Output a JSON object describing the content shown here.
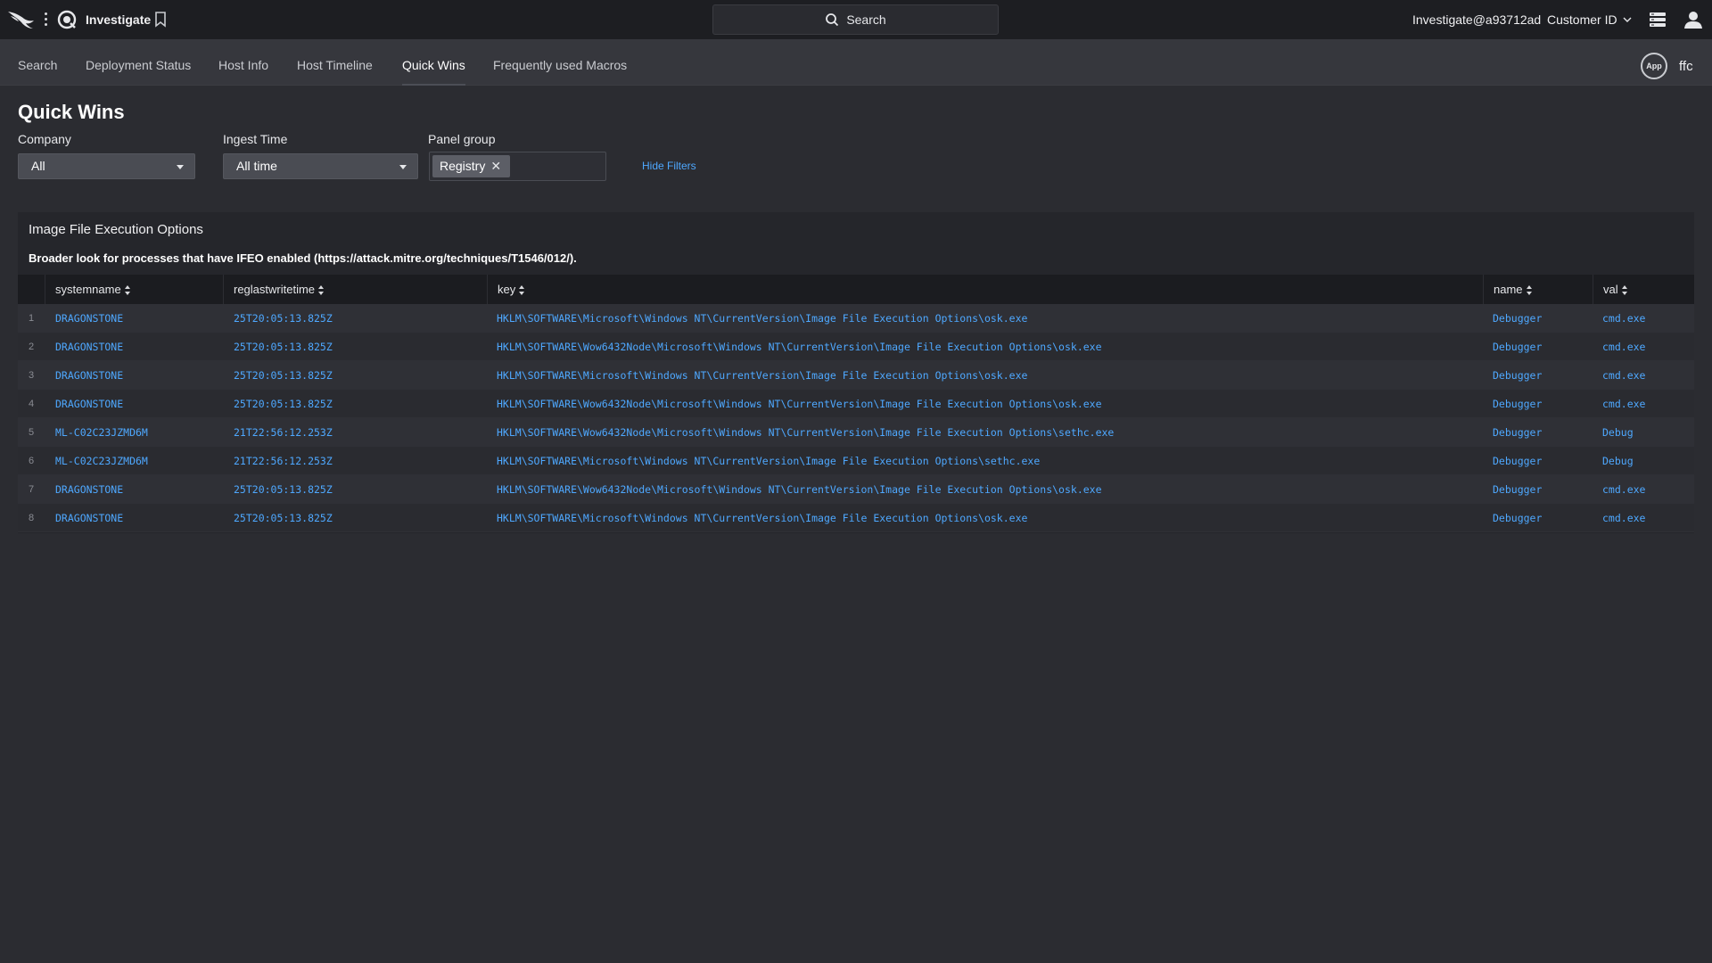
{
  "topbar": {
    "app_name": "Investigate",
    "search_label": "Search",
    "user": "Investigate@a93712ad",
    "customer_label": "Customer ID"
  },
  "tabs": [
    {
      "label": "Search"
    },
    {
      "label": "Deployment Status"
    },
    {
      "label": "Host Info"
    },
    {
      "label": "Host Timeline"
    },
    {
      "label": "Quick Wins",
      "active": true
    },
    {
      "label": "Frequently used Macros"
    }
  ],
  "app_badge": "App",
  "org_code": "ffc",
  "page": {
    "title": "Quick Wins",
    "filters": {
      "company": {
        "label": "Company",
        "value": "All"
      },
      "ingest_time": {
        "label": "Ingest Time",
        "value": "All time"
      },
      "panel_group": {
        "label": "Panel group",
        "chips": [
          "Registry"
        ]
      },
      "hide_filters": "Hide Filters"
    }
  },
  "panel": {
    "title": "Image File Execution Options",
    "description": "Broader look for processes that have IFEO enabled (https://attack.mitre.org/techniques/T1546/012/).",
    "columns": [
      "systemname",
      "reglastwritetime",
      "key",
      "name",
      "val"
    ],
    "rows": [
      {
        "idx": "1",
        "systemname": "DRAGONSTONE",
        "reglastwritetime": "25T20:05:13.825Z",
        "key": "HKLM\\SOFTWARE\\Microsoft\\Windows NT\\CurrentVersion\\Image File Execution Options\\osk.exe",
        "name": "Debugger",
        "val": "cmd.exe"
      },
      {
        "idx": "2",
        "systemname": "DRAGONSTONE",
        "reglastwritetime": "25T20:05:13.825Z",
        "key": "HKLM\\SOFTWARE\\Wow6432Node\\Microsoft\\Windows NT\\CurrentVersion\\Image File Execution Options\\osk.exe",
        "name": "Debugger",
        "val": "cmd.exe"
      },
      {
        "idx": "3",
        "systemname": "DRAGONSTONE",
        "reglastwritetime": "25T20:05:13.825Z",
        "key": "HKLM\\SOFTWARE\\Microsoft\\Windows NT\\CurrentVersion\\Image File Execution Options\\osk.exe",
        "name": "Debugger",
        "val": "cmd.exe"
      },
      {
        "idx": "4",
        "systemname": "DRAGONSTONE",
        "reglastwritetime": "25T20:05:13.825Z",
        "key": "HKLM\\SOFTWARE\\Wow6432Node\\Microsoft\\Windows NT\\CurrentVersion\\Image File Execution Options\\osk.exe",
        "name": "Debugger",
        "val": "cmd.exe"
      },
      {
        "idx": "5",
        "systemname": "ML-C02C23JZMD6M",
        "reglastwritetime": "21T22:56:12.253Z",
        "key": "HKLM\\SOFTWARE\\Wow6432Node\\Microsoft\\Windows NT\\CurrentVersion\\Image File Execution Options\\sethc.exe",
        "name": "Debugger",
        "val": "Debug"
      },
      {
        "idx": "6",
        "systemname": "ML-C02C23JZMD6M",
        "reglastwritetime": "21T22:56:12.253Z",
        "key": "HKLM\\SOFTWARE\\Microsoft\\Windows NT\\CurrentVersion\\Image File Execution Options\\sethc.exe",
        "name": "Debugger",
        "val": "Debug"
      },
      {
        "idx": "7",
        "systemname": "DRAGONSTONE",
        "reglastwritetime": "25T20:05:13.825Z",
        "key": "HKLM\\SOFTWARE\\Wow6432Node\\Microsoft\\Windows NT\\CurrentVersion\\Image File Execution Options\\osk.exe",
        "name": "Debugger",
        "val": "cmd.exe"
      },
      {
        "idx": "8",
        "systemname": "DRAGONSTONE",
        "reglastwritetime": "25T20:05:13.825Z",
        "key": "HKLM\\SOFTWARE\\Microsoft\\Windows NT\\CurrentVersion\\Image File Execution Options\\osk.exe",
        "name": "Debugger",
        "val": "cmd.exe"
      }
    ]
  },
  "colors": {
    "background": "#2b2c31",
    "topbar": "#1d1e22",
    "tabbar": "#36373d",
    "link": "#4ea8ff"
  },
  "icons": [
    "falcon-logo-icon",
    "kebab-menu-icon",
    "investigate-app-icon",
    "bookmark-icon",
    "search-icon",
    "chevron-down-icon",
    "layers-icon",
    "person-icon",
    "caret-down-icon",
    "close-icon",
    "sort-icon"
  ]
}
